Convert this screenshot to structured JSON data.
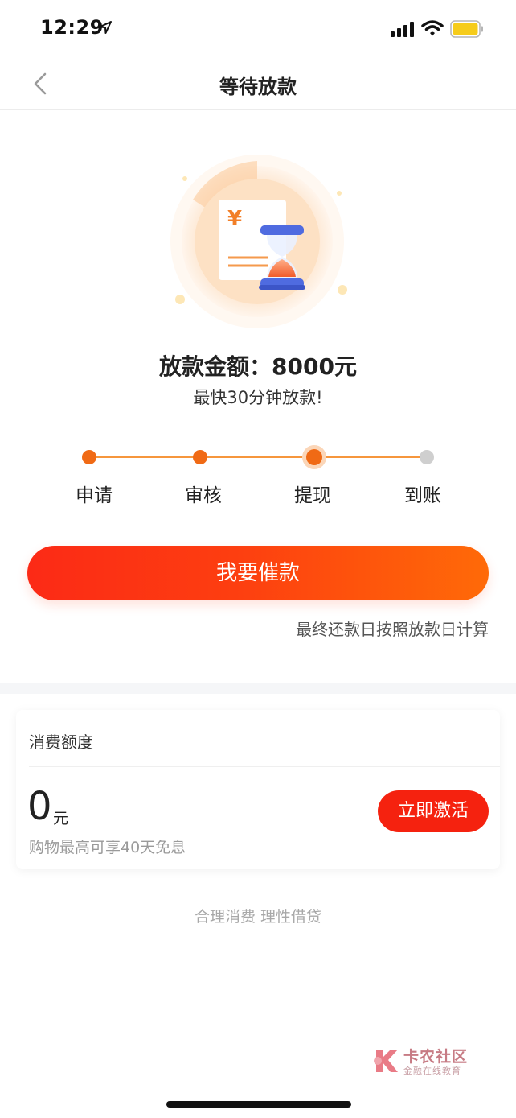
{
  "status_bar": {
    "time": "12:29"
  },
  "nav": {
    "title": "等待放款"
  },
  "hero": {
    "icon": "hourglass-document-icon",
    "symbol": "¥"
  },
  "summary": {
    "amount_text": "放款金额：8000元",
    "speed_text": "最快30分钟放款!"
  },
  "steps": {
    "current_index": 2,
    "items": [
      {
        "label": "申请",
        "state": "done"
      },
      {
        "label": "审核",
        "state": "done"
      },
      {
        "label": "提现",
        "state": "current"
      },
      {
        "label": "到账",
        "state": "pending"
      }
    ]
  },
  "actions": {
    "urge_label": "我要催款",
    "repay_note": "最终还款日按照放款日计算"
  },
  "credit_card": {
    "title": "消费额度",
    "value": "0",
    "unit": "元",
    "description": "购物最高可享40天免息",
    "activate_label": "立即激活"
  },
  "slogan": "合理消费 理性借贷",
  "watermark": {
    "title": "卡农社区",
    "subtitle": "金融在线教育"
  },
  "colors": {
    "accent": "#f56a12",
    "button_gradient_start": "#fc2a16",
    "button_gradient_end": "#ff6a08",
    "activate": "#f5220f",
    "pending": "#cfcfcf"
  }
}
